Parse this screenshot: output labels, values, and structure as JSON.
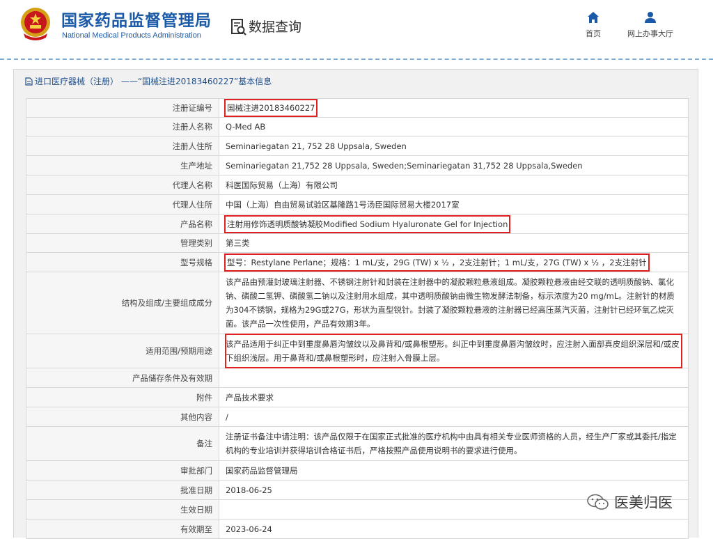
{
  "header": {
    "brand_cn": "国家药品监督管理局",
    "brand_en": "National Medical Products Administration",
    "query_label": "数据查询",
    "nav": [
      {
        "label": "首页",
        "icon": "home-icon"
      },
      {
        "label": "网上办事大厅",
        "icon": "user-icon"
      }
    ]
  },
  "breadcrumb": {
    "text": "进口医疗器械（注册） ——“国械注进20183460227”基本信息",
    "icon": "document-icon"
  },
  "rows": [
    {
      "key": "注册证编号",
      "value": "国械注进20183460227",
      "highlight": true
    },
    {
      "key": "注册人名称",
      "value": "Q-Med AB"
    },
    {
      "key": "注册人住所",
      "value": "Seminariegatan 21, 752 28 Uppsala, Sweden"
    },
    {
      "key": "生产地址",
      "value": "Seminariegatan 21,752 28 Uppsala, Sweden;Seminariegatan 31,752 28 Uppsala,Sweden"
    },
    {
      "key": "代理人名称",
      "value": "科医国际贸易（上海）有限公司"
    },
    {
      "key": "代理人住所",
      "value": "中国（上海）自由贸易试验区基隆路1号汤臣国际贸易大楼2017室"
    },
    {
      "key": "产品名称",
      "value": "注射用修饰透明质酸钠凝胶Modified Sodium Hyaluronate Gel for Injection",
      "highlight": true
    },
    {
      "key": "管理类别",
      "value": "第三类"
    },
    {
      "key": "型号规格",
      "value": "型号：Restylane Perlane；规格：1 mL/支，29G (TW) x ½ ，2支注射针；1 mL/支，27G (TW) x ½ ，2支注射针",
      "highlight": true
    },
    {
      "key": "结构及组成/主要组成成分",
      "value": "该产品由预灌封玻璃注射器、不锈钢注射针和封装在注射器中的凝胶颗粒悬液组成。凝胶颗粒悬液由经交联的透明质酸钠、氯化钠、磷酸二氢钾、磷酸氢二钠以及注射用水组成，其中透明质酸钠由微生物发酵法制备，标示浓度为20 mg/mL。注射针的材质为304不锈钢，规格为29G或27G，形状为直型锐针。封装了凝胶颗粒悬液的注射器已经高压蒸汽灭菌，注射针已经环氧乙烷灭菌。该产品一次性使用，产品有效期3年。",
      "multi": true
    },
    {
      "key": "适用范围/预期用途",
      "value": "该产品适用于纠正中到重度鼻唇沟皱纹以及鼻背和/或鼻根塑形。纠正中到重度鼻唇沟皱纹时，应注射入面部真皮组织深层和/或皮下组织浅层。用于鼻背和/或鼻根塑形时，应注射入骨膜上层。",
      "multi": true,
      "highlight_block": true
    },
    {
      "key": "产品储存条件及有效期",
      "value": ""
    },
    {
      "key": "附件",
      "value": "产品技术要求"
    },
    {
      "key": "其他内容",
      "value": "/"
    },
    {
      "key": "备注",
      "value": "注册证书备注中请注明：该产品仅限于在国家正式批准的医疗机构中由具有相关专业医师资格的人员，经生产厂家或其委托/指定机构的专业培训并获得培训合格证书后，严格按照产品使用说明书的要求进行使用。",
      "multi": true
    },
    {
      "key": "审批部门",
      "value": "国家药品监督管理局"
    },
    {
      "key": "批准日期",
      "value": "2018-06-25"
    },
    {
      "key": "生效日期",
      "value": ""
    },
    {
      "key": "有效期至",
      "value": "2023-06-24"
    }
  ],
  "watermark": {
    "text": "医美归医",
    "icon": "wechat-icon"
  },
  "colors": {
    "brand_blue": "#1a5aa8",
    "highlight_red": "#e02020",
    "frame_bg": "#f1f1f1"
  }
}
